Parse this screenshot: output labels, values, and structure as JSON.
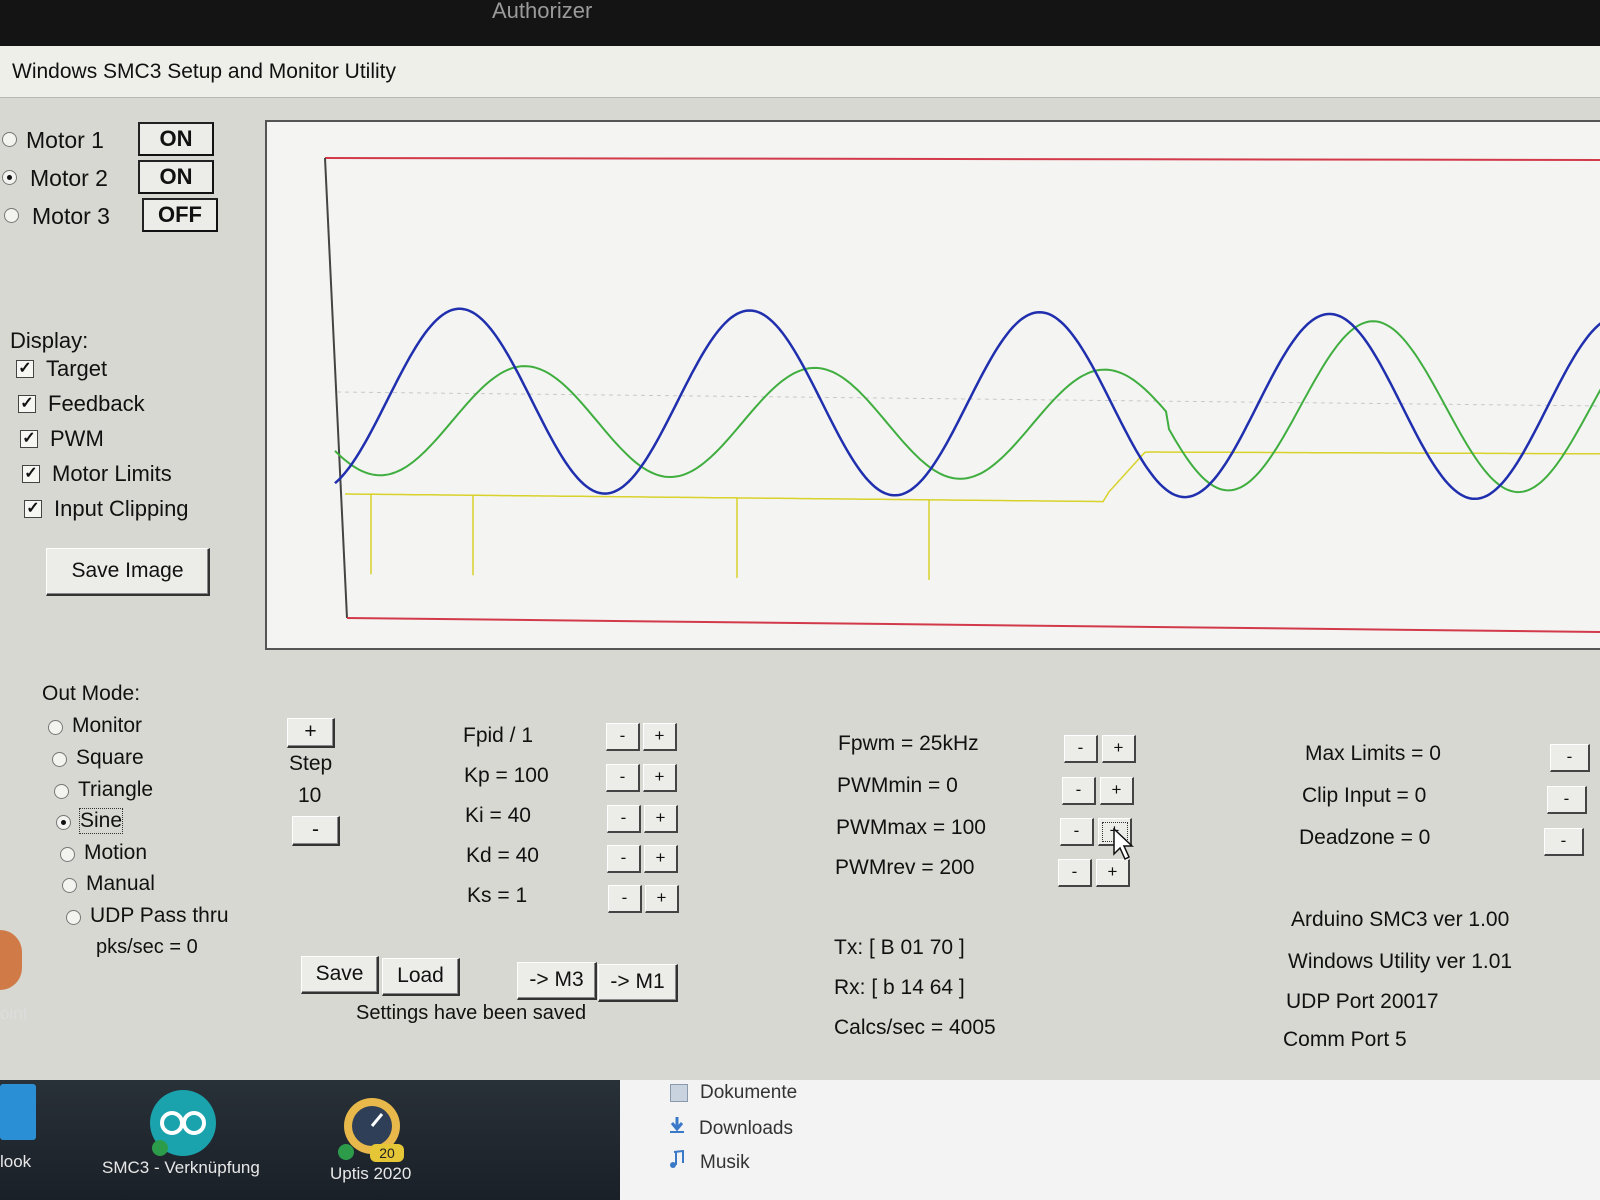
{
  "screen": {
    "top_title": "Authorizer"
  },
  "window": {
    "title": "Windows SMC3 Setup and Monitor Utility"
  },
  "motors": [
    {
      "label": "Motor 1",
      "state": "ON",
      "selected": false
    },
    {
      "label": "Motor 2",
      "state": "ON",
      "selected": true
    },
    {
      "label": "Motor 3",
      "state": "OFF",
      "selected": false
    }
  ],
  "display": {
    "title": "Display:",
    "options": [
      {
        "label": "Target",
        "checked": true
      },
      {
        "label": "Feedback",
        "checked": true
      },
      {
        "label": "PWM",
        "checked": true
      },
      {
        "label": "Motor Limits",
        "checked": true
      },
      {
        "label": "Input Clipping",
        "checked": true
      }
    ],
    "save_image": "Save Image"
  },
  "plot": {
    "colors": {
      "target": "#1f2fae",
      "feedback": "#3fae3f",
      "pwm": "#d8d22a",
      "limits": "#d23a4a"
    }
  },
  "out_mode": {
    "title": "Out Mode:",
    "options": [
      "Monitor",
      "Square",
      "Triangle",
      "Sine",
      "Motion",
      "Manual",
      "UDP Pass thru"
    ],
    "selected": "Sine",
    "pks": "pks/sec = 0"
  },
  "step": {
    "plus": "+",
    "label": "Step",
    "value": "10",
    "minus": "-"
  },
  "pid": {
    "rows": [
      "Fpid / 1",
      "Kp = 100",
      "Ki = 40",
      "Kd = 40",
      "Ks = 1"
    ],
    "minus": "-",
    "plus": "+"
  },
  "pwm": {
    "rows": [
      "Fpwm = 25kHz",
      "PWMmin = 0",
      "PWMmax = 100",
      "PWMrev = 200"
    ],
    "minus": "-",
    "plus": "+"
  },
  "limits": {
    "rows": [
      "Max Limits = 0",
      "Clip Input = 0",
      "Deadzone = 0"
    ]
  },
  "buttons": {
    "save": "Save",
    "load": "Load",
    "to_m3": "-> M3",
    "to_m1": "-> M1"
  },
  "status": "Settings have been saved",
  "comm": {
    "tx": "Tx: [ B 01 70 ]",
    "rx": "Rx: [ b 14 64 ]",
    "calcs": "Calcs/sec = 4005"
  },
  "info": {
    "arduino": "Arduino SMC3 ver 1.00",
    "utility": "Windows Utility ver 1.01",
    "udp": "UDP Port 20017",
    "comm_port": "Comm Port 5"
  },
  "taskbar": {
    "items": [
      "look",
      "SMC3 - Verknüpfung",
      "Uptis 2020"
    ],
    "badge": "20",
    "edge_label": "oint"
  },
  "explorer": {
    "folders": [
      "Dokumente",
      "Downloads",
      "Musik"
    ]
  }
}
